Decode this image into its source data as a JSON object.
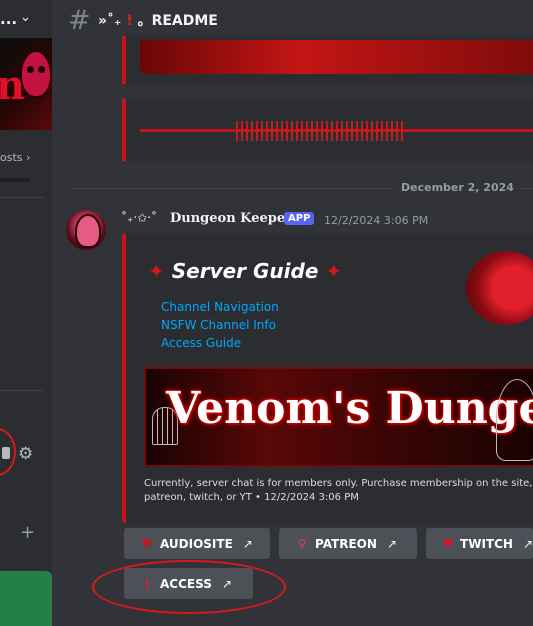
{
  "sidebar": {
    "server_name": "...",
    "boosts_label": "osts",
    "boosts_chevron": "›",
    "add_icon": "+",
    "settings_icon": "gear-icon"
  },
  "header": {
    "channel_prefix": "»˚₊",
    "channel_bang": "!",
    "channel_suffix": "。README"
  },
  "date_divider": "December 2, 2024",
  "message": {
    "author_prefix": "˚₊‧✩‧˚",
    "author": "Dungeon Keeper",
    "badge": "APP",
    "timestamp": "12/2/2024 3:06 PM",
    "embed": {
      "title": "Server Guide",
      "links": [
        "Channel Navigation",
        "NSFW Channel Info",
        "Access Guide"
      ],
      "hero_text": "Venom's Dungeon",
      "description": "Currently, server chat is for members only. Purchase membership on the site, patreon, twitch, or YT • 12/2/2024 3:06 PM"
    },
    "buttons": [
      {
        "label": "AUDIOSITE",
        "icon": "heart-icon"
      },
      {
        "label": "PATREON",
        "icon": "patreon-icon"
      },
      {
        "label": "TWITCH",
        "icon": "heart-icon"
      },
      {
        "label": "ACCESS",
        "icon": "exclamation-icon"
      }
    ]
  },
  "colors": {
    "accent_red": "#c8131b",
    "link_blue": "#00a8fc",
    "app_badge": "#5865f2"
  }
}
